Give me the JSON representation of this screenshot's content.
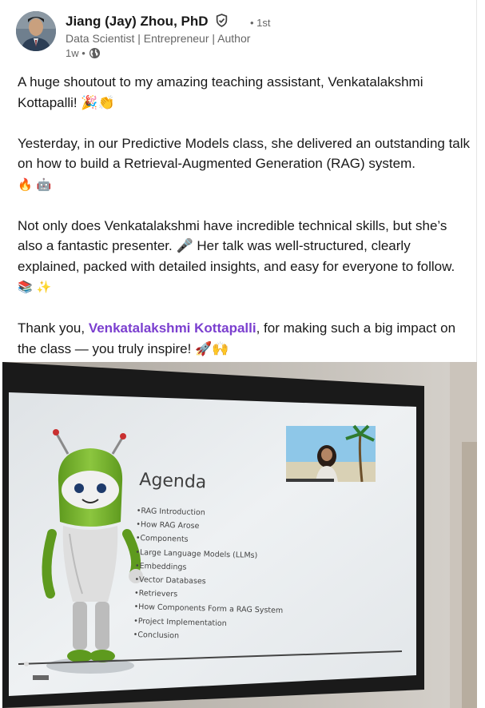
{
  "post": {
    "author_name": "Jiang (Jay) Zhou, PhD",
    "connection_degree": "• 1st",
    "headline": "Data Scientist | Entrepreneur | Author",
    "time_ago": "1w •",
    "paragraphs": {
      "p1": "A huge shoutout to my amazing teaching assistant, Venkatalakshmi Kottapalli! 🎉👏",
      "p2": "Yesterday, in our Predictive Models class, she delivered an outstanding talk on how to build a Retrieval-Augmented Generation (RAG) system.",
      "p2_emoji": "🔥 🤖",
      "p3": "Not only does Venkatalakshmi have incredible technical skills, but she’s also a fantastic presenter. 🎤 Her talk was well-structured, clearly explained, packed with detailed insights, and easy for everyone to follow.",
      "p3_emoji": "📚 ✨",
      "p4_before": "Thank you, ",
      "p4_mention": "Venkatalakshmi Kottapalli",
      "p4_after": ", for making such a big impact on the class — you truly inspire! 🚀🙌"
    }
  },
  "slide": {
    "title": "Agenda",
    "items": [
      "•RAG Introduction",
      "•How RAG Arose",
      "•Components",
      "•Large Language Models (LLMs)",
      "•Embeddings",
      "•Vector Databases",
      "•Retrievers",
      "•How Components Form a RAG System",
      "•Project Implementation",
      "•Conclusion"
    ]
  },
  "colors": {
    "mention": "#7b3fcf",
    "meta_text": "#666666",
    "slide_bg": "#e9edf0",
    "robot_green": "#7cb82f"
  }
}
